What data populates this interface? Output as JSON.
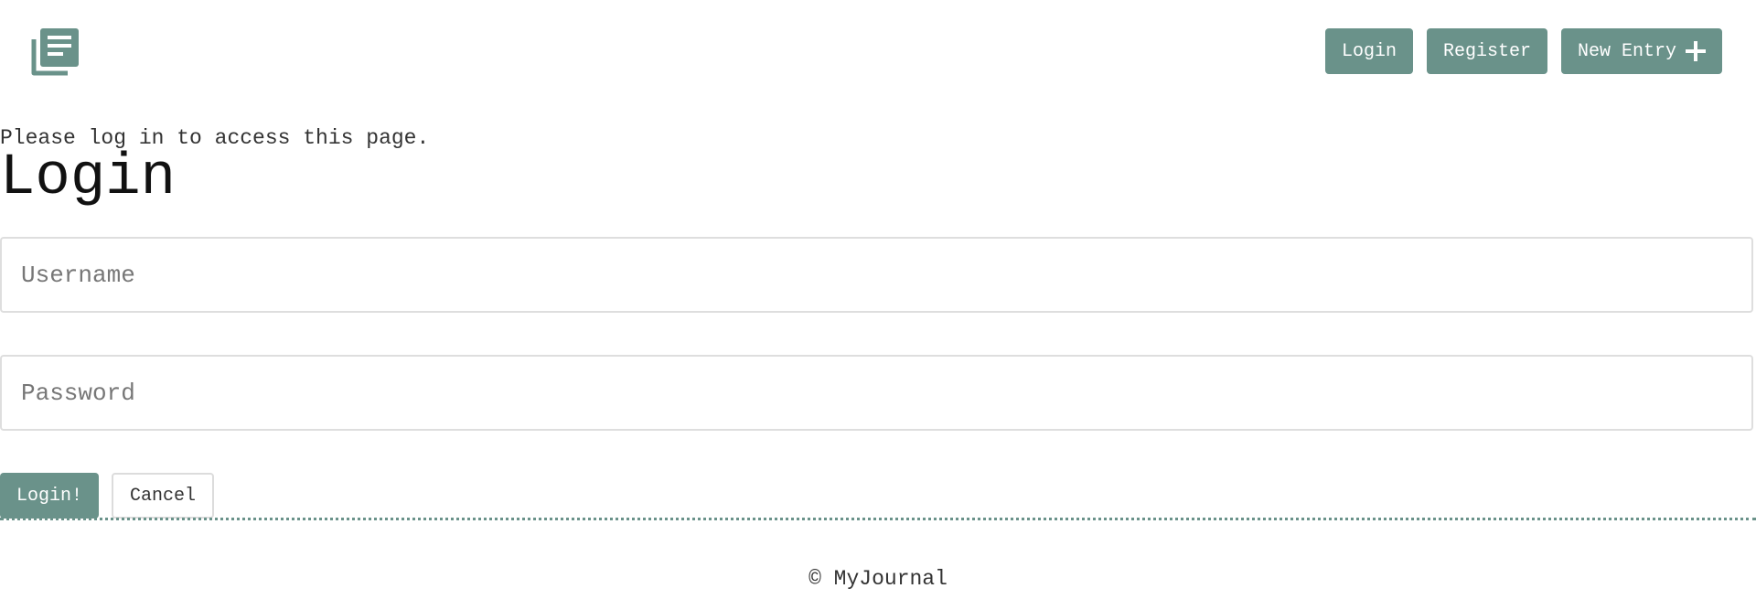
{
  "header": {
    "logo_icon": "journal-stack-icon",
    "nav": {
      "login_label": "Login",
      "register_label": "Register",
      "new_entry_label": "New Entry",
      "new_entry_icon": "plus-icon"
    }
  },
  "main": {
    "notice": "Please log in to access this page.",
    "title": "Login",
    "form": {
      "username_placeholder": "Username",
      "username_value": "",
      "password_placeholder": "Password",
      "password_value": "",
      "submit_label": "Login!",
      "cancel_label": "Cancel"
    }
  },
  "footer": {
    "text": "© MyJournal"
  },
  "colors": {
    "accent": "#6a928a",
    "text": "#333333",
    "border": "#dedede"
  }
}
